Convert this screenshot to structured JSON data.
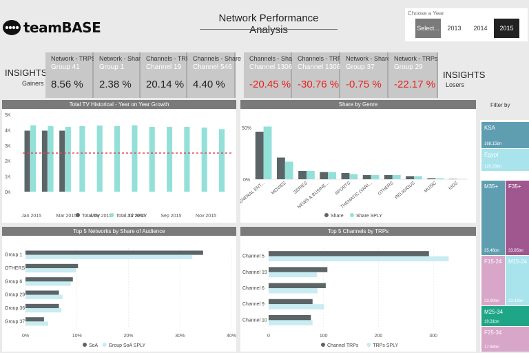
{
  "header": {
    "logo_text": "teamBASE",
    "title": "Network Performance Analysis"
  },
  "year_slicer": {
    "label": "Choose a Year",
    "options": [
      "Select...",
      "2013",
      "2014",
      "2015"
    ],
    "selected": "2015"
  },
  "insights": {
    "left_title": "INSIGHTS",
    "left_sub": "Gainers",
    "right_title": "INSIGHTS",
    "right_sub": "Losers"
  },
  "gainers": [
    {
      "title": "Network - TRPS",
      "subject": "Group 41",
      "value": "8.56 %"
    },
    {
      "title": "Network - Share",
      "subject": "Group 1",
      "value": "2.38 %"
    },
    {
      "title": "Channels - TRPs",
      "subject": "Channel 19",
      "value": "20.14 %"
    },
    {
      "title": "Channels - Share",
      "subject": "Channel 546",
      "value": "4.40 %"
    }
  ],
  "losers": [
    {
      "title": "Channels - Share",
      "subject": "Channel 1306",
      "value": "-20.45 %"
    },
    {
      "title": "Channels - TRPs",
      "subject": "Channel 1306",
      "value": "-30.76 %"
    },
    {
      "title": "Network - Share",
      "subject": "Group 37",
      "value": "-0.75 %"
    },
    {
      "title": "Network - TRPs",
      "subject": "Group 29",
      "value": "-22.17 %"
    }
  ],
  "filter": {
    "title": "Filter by",
    "countries": [
      {
        "name": "KSA",
        "value": "168.15bn",
        "color": "#5f9eb1"
      },
      {
        "name": "Egypt",
        "value": "120.28bn",
        "color": "#a9e3ec"
      }
    ],
    "demos": [
      {
        "name": "M35+",
        "value": "35.46bn",
        "color": "#5f9eb1"
      },
      {
        "name": "F35+",
        "value": "33.85bn",
        "color": "#a0568f"
      },
      {
        "name": "F15-24",
        "value": "23.90bn",
        "color": "#d7a6c8"
      },
      {
        "name": "M15-24",
        "value": "23.43bn",
        "color": "#a9e3ec"
      },
      {
        "name": "M25-34",
        "value": "19.31bn",
        "color": "#1fa687"
      },
      {
        "name": "F25-34",
        "value": "17.68bn",
        "color": "#d7a6c8"
      }
    ]
  },
  "chart_data": [
    {
      "type": "bar",
      "title": "Total TV Historical - Year on Year Growth",
      "categories": [
        "Jan 2015",
        "Feb 2015",
        "Mar 2015",
        "Apr 2015",
        "May 2015",
        "Jun 2015",
        "Jul 2015",
        "Aug 2015",
        "Sep 2015",
        "Oct 2015",
        "Nov 2015",
        "Dec 2015"
      ],
      "x_tick_labels": [
        "Jan 2015",
        "Mar 2015",
        "May 2015",
        "Jul 2015",
        "Sep 2015",
        "Nov 2015"
      ],
      "y_ticks": [
        "0K",
        "1K",
        "2K",
        "3K",
        "4K",
        "5K"
      ],
      "ylim": [
        0,
        5000
      ],
      "reference_line": 2500,
      "series": [
        {
          "name": "Total TV",
          "color": "#5b6466",
          "values": [
            3950,
            3950,
            3950,
            null,
            null,
            null,
            null,
            null,
            null,
            null,
            null,
            null
          ]
        },
        {
          "name": "Total TV SPLY",
          "color": "#93e0d9",
          "values": [
            4300,
            4250,
            4200,
            4250,
            4280,
            4250,
            4300,
            4200,
            4200,
            4200,
            4150,
            4050
          ]
        }
      ],
      "legend": "bottom"
    },
    {
      "type": "bar",
      "title": "Share by Genre",
      "categories": [
        "GENERAL ENT...",
        "MOVIES",
        "SERIES",
        "NEWS & BUSINE...",
        "SPORTS",
        "THEMATIC (VARI...",
        "OTHERS",
        "RELIGIOUS",
        "MUSIC",
        "KIDS"
      ],
      "y_ticks": [
        "0%",
        "50%"
      ],
      "ylim": [
        0,
        60
      ],
      "series": [
        {
          "name": "Share",
          "color": "#5b6466",
          "values": [
            46,
            21,
            8,
            7,
            6,
            4,
            4,
            3,
            1,
            0.3
          ]
        },
        {
          "name": "Share SPLY",
          "color": "#93e0d9",
          "values": [
            51,
            17,
            8,
            7,
            5,
            4,
            4,
            3,
            1,
            0.3
          ]
        }
      ],
      "legend": "bottom"
    },
    {
      "type": "bar",
      "orientation": "horizontal",
      "title": "Top 5 Networks by Share of Audience",
      "categories": [
        "Group 1",
        "OTHERS",
        "Group 6",
        "Group 29",
        "Group 36",
        "Group 37"
      ],
      "x_ticks": [
        "0%",
        "10%",
        "20%",
        "30%",
        "40%"
      ],
      "xlim": [
        0,
        40
      ],
      "series": [
        {
          "name": "SoA",
          "color": "#5b6466",
          "values": [
            34.5,
            10.2,
            9.2,
            6.5,
            6.5,
            3.6
          ]
        },
        {
          "name": "Group SoA SPLY",
          "color": "#c9ecf3",
          "values": [
            32.4,
            9.8,
            8.8,
            7.2,
            7.0,
            4.4
          ]
        }
      ],
      "legend": "bottom"
    },
    {
      "type": "bar",
      "orientation": "horizontal",
      "title": "Top 5 Channels by TRPs",
      "categories": [
        "Channel 5",
        "Channel 19",
        "Channel 6",
        "Channel 9",
        "Channel 10"
      ],
      "x_ticks": [
        "0",
        "100",
        "200",
        "300"
      ],
      "xlim": [
        0,
        350
      ],
      "series": [
        {
          "name": "Channel TRPs",
          "color": "#5b6466",
          "values": [
            292,
            107,
            104,
            80,
            77
          ]
        },
        {
          "name": "TRPs SPLY",
          "color": "#c9ecf3",
          "values": [
            328,
            88,
            89,
            101,
            80
          ]
        }
      ],
      "legend": "bottom"
    }
  ]
}
